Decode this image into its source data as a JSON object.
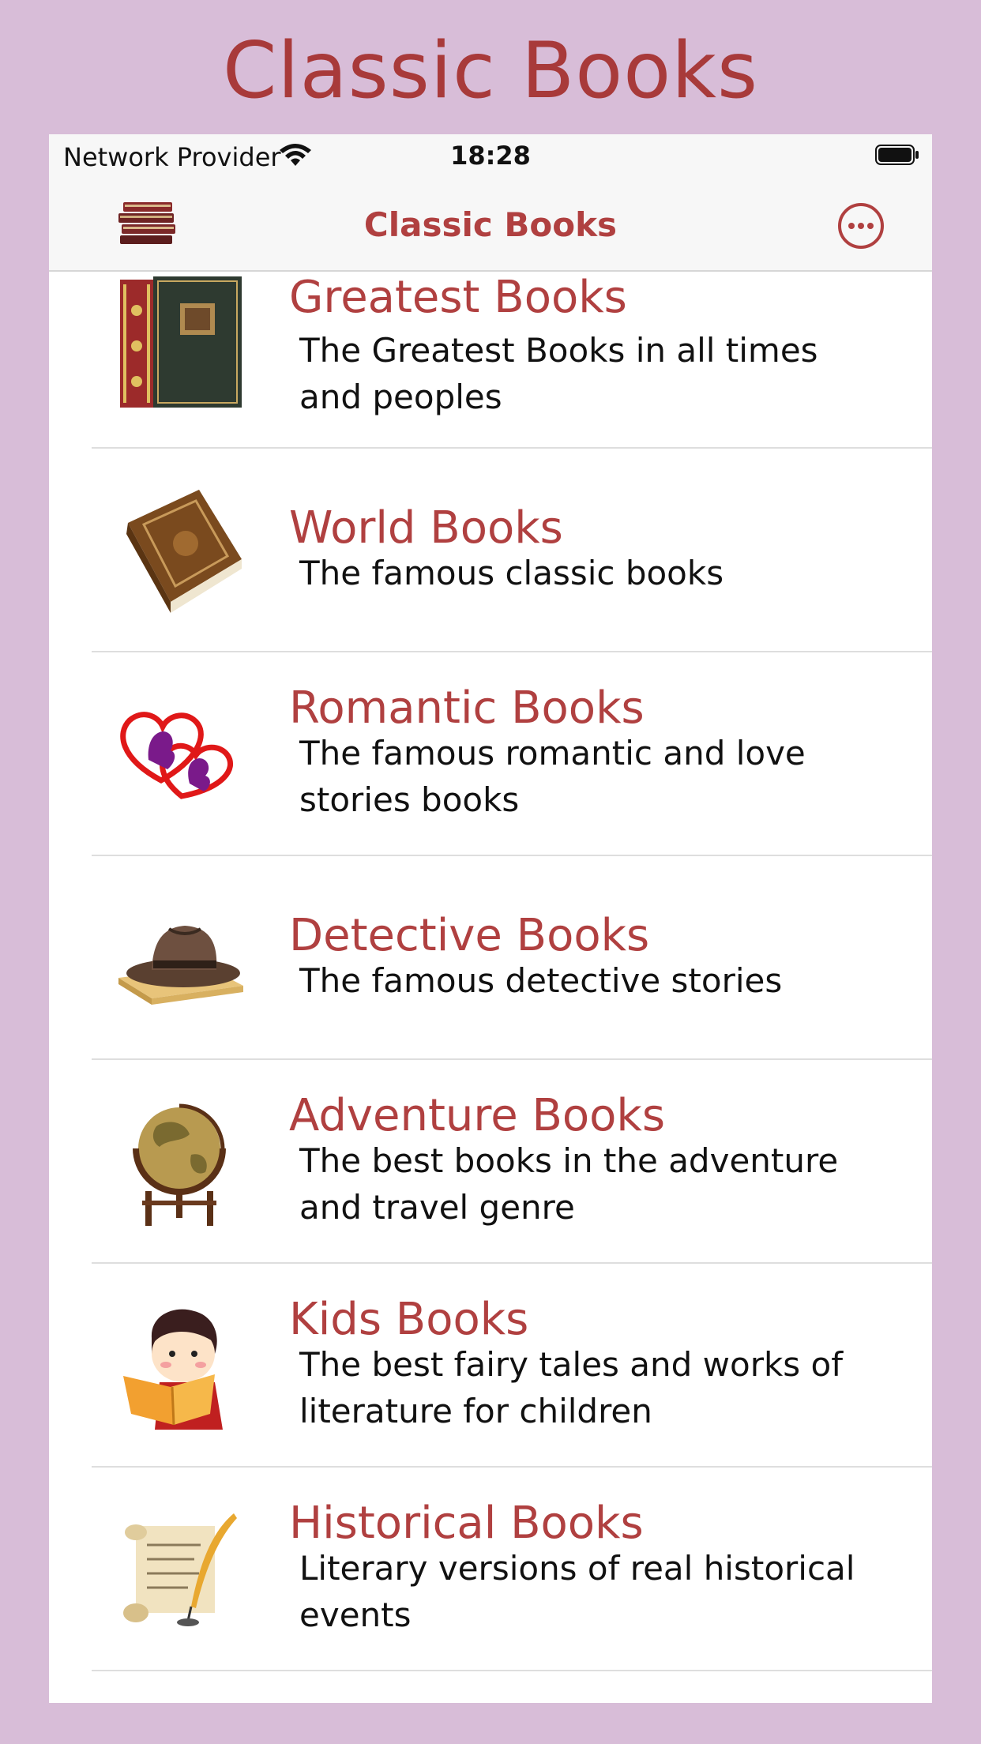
{
  "promo": {
    "title": "Classic Books"
  },
  "status_bar": {
    "carrier": "Network Provider",
    "time": "18:28"
  },
  "nav": {
    "title": "Classic Books"
  },
  "categories": [
    {
      "title": "Greatest Books",
      "description": "The Greatest Books in all times and peoples",
      "icon": "greatest-book-icon"
    },
    {
      "title": "World Books",
      "description": "The famous classic books",
      "icon": "world-book-icon"
    },
    {
      "title": "Romantic Books",
      "description": "The famous romantic and love stories books",
      "icon": "romantic-hearts-icon"
    },
    {
      "title": "Detective Books",
      "description": "The famous detective stories",
      "icon": "detective-hat-icon"
    },
    {
      "title": "Adventure Books",
      "description": "The best books in the adventure and travel genre",
      "icon": "globe-icon"
    },
    {
      "title": "Kids Books",
      "description": "The best fairy tales and works of literature for children",
      "icon": "kid-reading-icon"
    },
    {
      "title": "Historical Books",
      "description": "Literary versions of real historical events",
      "icon": "scroll-quill-icon"
    }
  ],
  "colors": {
    "accent": "#b04040",
    "background": "#d8bdd8"
  }
}
